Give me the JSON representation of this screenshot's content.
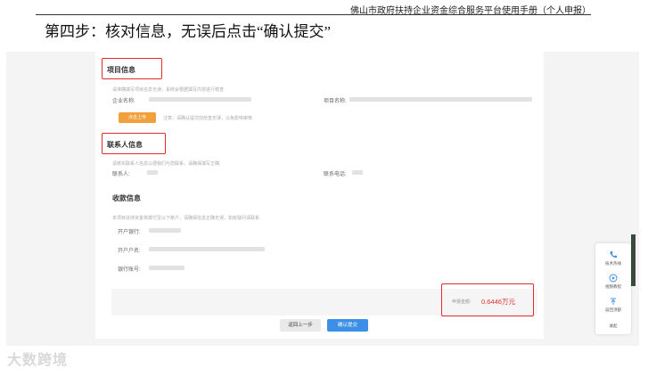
{
  "doc": {
    "header": "佛山市政府扶持企业资金综合服务平台使用手册（个人申报）",
    "step_title": "第四步：核对信息，无误后点击“确认提交”"
  },
  "project": {
    "title": "项目信息",
    "desc": "请准确填写项目信息无误，系统会根据填写内容进行核查",
    "company_label": "企业名称:",
    "project_label": "项目名称:",
    "upload_button": "点击上传",
    "upload_note": "注意：请确认提交前检查无误，以免影响审核"
  },
  "contact": {
    "title": "联系人信息",
    "desc": "请核实联系人信息以便我们与您联系，请确保填写正确",
    "name_label": "联系人:",
    "phone_label": "联系电话:"
  },
  "payment": {
    "title": "收款信息",
    "desc": "本项目扶持资金将拨付至以下账户，请确保信息正确无误，如有疑问请联系",
    "bank_label": "开户银行:",
    "holder_label": "开户户名:",
    "account_label": "银行账号:"
  },
  "total": {
    "label": "申报金额:",
    "value": "0.6446万元"
  },
  "buttons": {
    "prev": "返回上一步",
    "submit": "确认提交"
  },
  "side": {
    "hotline": "技术热线",
    "tutorial": "视频教程",
    "top": "返回顶部",
    "favorite": "收起"
  },
  "watermark": "大数跨境",
  "colors": {
    "highlight": "#e12b2b",
    "primary": "#3b8fe6",
    "upload": "#f0a13b"
  }
}
